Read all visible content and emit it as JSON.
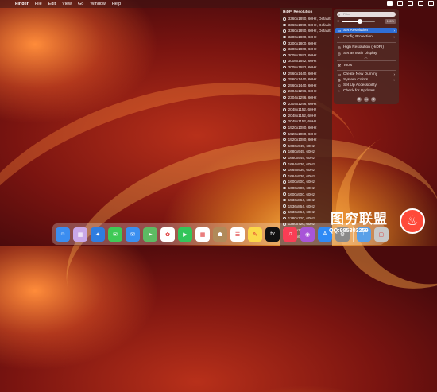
{
  "menubar": {
    "apple": "",
    "items": [
      "Finder",
      "File",
      "Edit",
      "View",
      "Go",
      "Window",
      "Help"
    ]
  },
  "resolution_list": {
    "header": "HiDPI Resolution",
    "selected_index": 25,
    "items": [
      "3360x1890, 60Hz, Default",
      "3360x1890, 60Hz, Default",
      "3360x1890, 60Hz, Default",
      "3200x1800, 60Hz",
      "3200x1800, 60Hz",
      "3200x1800, 60Hz",
      "3008x1692, 60Hz",
      "3008x1692, 60Hz",
      "3008x1692, 60Hz",
      "2560x1440, 60Hz",
      "2560x1440, 60Hz",
      "2560x1440, 60Hz",
      "2304x1296, 60Hz",
      "2304x1296, 60Hz",
      "2304x1296, 60Hz",
      "2048x1152, 60Hz",
      "2048x1152, 60Hz",
      "2048x1152, 60Hz",
      "1920x1080, 60Hz",
      "1920x1080, 60Hz",
      "1920x1080, 60Hz",
      "1680x945, 60Hz",
      "1680x945, 60Hz",
      "1680x945, 60Hz",
      "1664x936, 60Hz",
      "1664x936, 60Hz",
      "1664x936, 60Hz",
      "1600x900, 60Hz",
      "1600x900, 60Hz",
      "1600x900, 60Hz",
      "1536x864, 60Hz",
      "1536x864, 60Hz",
      "1536x864, 60Hz",
      "1280x720, 60Hz",
      "1280x720, 60Hz",
      "1280x720, 60Hz",
      "1280x600, 60Hz"
    ]
  },
  "popover": {
    "search_placeholder": "Filter",
    "slider_value_label": "100%",
    "slider_level": 0.55,
    "items_top": [
      {
        "label": "Set Resolution",
        "highlighted": true,
        "arrow": "›"
      },
      {
        "label": "Config Protection",
        "highlighted": false,
        "arrow": "›"
      }
    ],
    "items_mid": [
      {
        "label": "High Resolution (HiDPI)"
      },
      {
        "label": "Set as Main Display"
      }
    ],
    "tools_label": "Tools",
    "items_bottom": [
      {
        "label": "Create New Dummy",
        "arrow": "›"
      },
      {
        "label": "System Colors",
        "arrow": "›"
      },
      {
        "label": "Set Up Accessibility"
      },
      {
        "label": "Check for Updates"
      }
    ]
  },
  "dock": {
    "apps": [
      {
        "name": "finder",
        "color": "#3b8df0",
        "glyph": "☺"
      },
      {
        "name": "launchpad",
        "color": "#c9a8e8",
        "glyph": "▦"
      },
      {
        "name": "safari",
        "color": "#2f7de0",
        "glyph": "✦"
      },
      {
        "name": "messages",
        "color": "#3fca56",
        "glyph": "✉"
      },
      {
        "name": "mail",
        "color": "#3a8ff0",
        "glyph": "✉"
      },
      {
        "name": "maps",
        "color": "#5dbb63",
        "glyph": "➤"
      },
      {
        "name": "photos",
        "color": "#ffffff",
        "glyph": "✿"
      },
      {
        "name": "facetime",
        "color": "#33c55a",
        "glyph": "▶"
      },
      {
        "name": "calendar",
        "color": "#ffffff",
        "glyph": "▦"
      },
      {
        "name": "contacts",
        "color": "#b08a5a",
        "glyph": "☗"
      },
      {
        "name": "reminders",
        "color": "#ffffff",
        "glyph": "☰"
      },
      {
        "name": "notes",
        "color": "#fbd849",
        "glyph": "✎"
      },
      {
        "name": "tv",
        "color": "#111111",
        "glyph": "tv"
      },
      {
        "name": "music",
        "color": "#fa3d55",
        "glyph": "♫"
      },
      {
        "name": "podcasts",
        "color": "#a855d8",
        "glyph": "◉"
      },
      {
        "name": "app-store",
        "color": "#2f8af5",
        "glyph": "A"
      },
      {
        "name": "system-settings",
        "color": "#8a8a8a",
        "glyph": "⚙"
      },
      {
        "name": "downloads",
        "color": "#5aa0e8",
        "glyph": "↓"
      },
      {
        "name": "trash",
        "color": "#c8c8c8",
        "glyph": "▢"
      }
    ]
  },
  "watermark": {
    "title": "图穷联盟",
    "qq": "QQ:985303259"
  }
}
